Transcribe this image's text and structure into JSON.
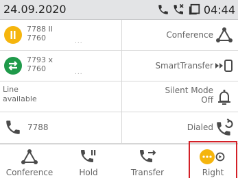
{
  "header": {
    "date": "24.09.2020",
    "time": "04:44",
    "icons": [
      "phone-icon",
      "missed-call-icon",
      "device-icon"
    ]
  },
  "grid": {
    "left": [
      {
        "type": "account",
        "status": "hold",
        "status_color": "#f5b50d",
        "number": "7788 II",
        "sub": "7760",
        "dots": "..."
      },
      {
        "type": "account",
        "status": "transfer",
        "status_color": "#1f9a4a",
        "number": "7793 x",
        "sub": "7760",
        "dots": "..."
      },
      {
        "type": "line",
        "line1": "Line",
        "line2": "available"
      },
      {
        "type": "call",
        "number": "7788"
      }
    ],
    "right": [
      {
        "label": "Conference",
        "icon": "conference-icon"
      },
      {
        "label": "SmartTransfer",
        "icon": "smart-transfer-icon"
      },
      {
        "label1": "Silent Mode",
        "label2": "Off",
        "icon": "bell-icon"
      },
      {
        "label": "Dialed",
        "icon": "dialed-icon"
      }
    ]
  },
  "softkeys": [
    {
      "label": "Conference",
      "icon": "conference-icon"
    },
    {
      "label": "Hold",
      "icon": "hold-icon"
    },
    {
      "label": "Transfer",
      "icon": "transfer-icon"
    },
    {
      "label": "Right",
      "icon": "more-icon",
      "highlighted": true
    }
  ],
  "colors": {
    "icon": "#4a4a4a",
    "hold": "#f5b50d",
    "transfer": "#1f9a4a",
    "highlight": "#d32027",
    "more": "#f5b50d"
  }
}
